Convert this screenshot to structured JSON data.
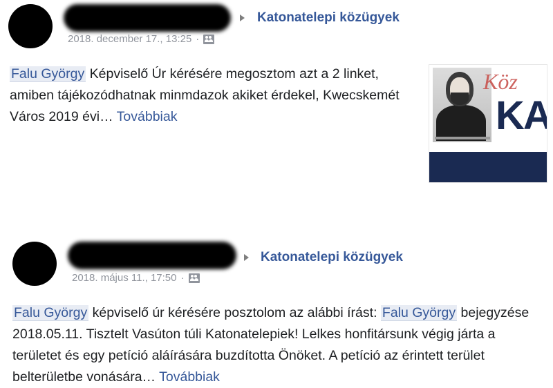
{
  "posts": [
    {
      "group": "Katonatelepi közügyek",
      "timestamp": "2018. december 17., 13:25",
      "mention": "Falu György",
      "text_after_mention": " Képviselő Úr kérésére megosztom azt a 2 linket, amiben tájékozódhatnak minmdazok akiket érdekel, Kwecskemét Város 2019 évi…",
      "more_label": "Továbbiak",
      "thumbnail_text": {
        "script": "Köz",
        "big": "KA"
      }
    },
    {
      "group": "Katonatelepi közügyek",
      "timestamp": "2018. május 11., 17:50",
      "mention1": "Falu György",
      "text_mid": " képviselő úr kérésére posztolom az alábbi írást: ",
      "mention2": "Falu György",
      "text_after": " bejegyzése 2018.05.11. Tisztelt Vasúton túli Katonatelepiek! Lelkes honfitársunk végig járta a területet és egy petíció aláírására buzdította Önöket. A petíció az érintett terület belterületbe vonására…",
      "more_label": "Továbbiak"
    }
  ],
  "icons": {
    "group_icon": "group-icon",
    "arrow": "right-arrow-icon"
  },
  "colors": {
    "link": "#365899",
    "meta": "#90949c",
    "mention_bg": "#e8ecf4"
  }
}
